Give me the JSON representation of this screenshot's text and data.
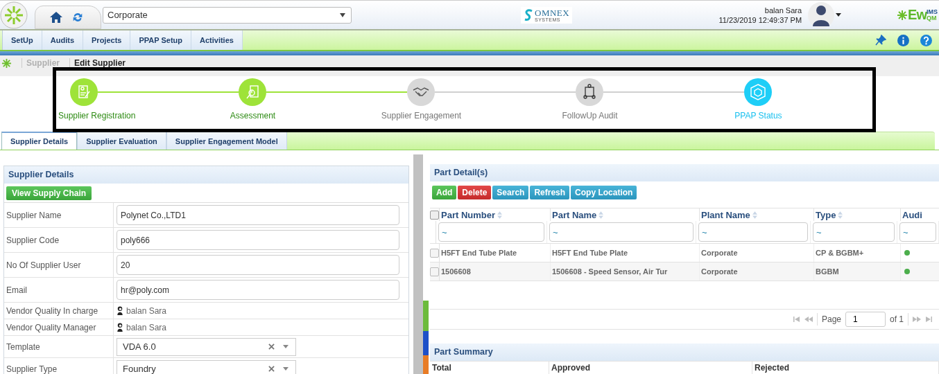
{
  "header": {
    "site_select": {
      "value": "Corporate"
    },
    "brand": {
      "name": "OMNEX",
      "tagline": "SYSTEMS"
    },
    "user": {
      "name": "balan Sara",
      "datetime": "11/23/2019 12:49:37 PM"
    },
    "product_logo": {
      "main": "Ew",
      "top": "IMS",
      "bottom": "QM"
    }
  },
  "nav": {
    "tabs": [
      {
        "label": "SetUp"
      },
      {
        "label": "Audits"
      },
      {
        "label": "Projects"
      },
      {
        "label": "PPAP Setup"
      },
      {
        "label": "Activities"
      }
    ]
  },
  "breadcrumb": [
    {
      "label": "Supplier",
      "current": false
    },
    {
      "label": "Edit Supplier",
      "current": true
    }
  ],
  "stepper": [
    {
      "label": "Supplier Registration",
      "done": true,
      "current": false
    },
    {
      "label": "Assessment",
      "done": true,
      "current": false
    },
    {
      "label": "Supplier Engagement",
      "done": false,
      "current": false
    },
    {
      "label": "FollowUp Audit",
      "done": false,
      "current": false
    },
    {
      "label": "PPAP Status",
      "done": false,
      "current": true
    }
  ],
  "tabs": [
    {
      "label": "Supplier Details",
      "selected": true
    },
    {
      "label": "Supplier Evaluation",
      "selected": false
    },
    {
      "label": "Supplier Engagement Model",
      "selected": false
    }
  ],
  "supplier_details": {
    "title": "Supplier Details",
    "button": "View Supply Chain",
    "fields": [
      {
        "label": "Supplier Name",
        "kind": "text",
        "value": "Polynet Co.,LTD1"
      },
      {
        "label": "Supplier Code",
        "kind": "text",
        "value": "poly666"
      },
      {
        "label": "No Of Supplier User",
        "kind": "text",
        "value": "20"
      },
      {
        "label": "Email",
        "kind": "text",
        "value": "hr@poly.com"
      },
      {
        "label": "Vendor Quality In charge",
        "kind": "person",
        "value": "balan Sara"
      },
      {
        "label": "Vendor Quality Manager",
        "kind": "person",
        "value": "balan Sara"
      },
      {
        "label": "Template",
        "kind": "select",
        "value": "VDA 6.0"
      },
      {
        "label": "Supplier Type",
        "kind": "select",
        "value": "Foundry"
      }
    ]
  },
  "part_details": {
    "title": "Part Detail(s)",
    "buttons": [
      {
        "label": "Add",
        "kind": "add"
      },
      {
        "label": "Delete",
        "kind": "delete"
      },
      {
        "label": "Search",
        "kind": "action"
      },
      {
        "label": "Refresh",
        "kind": "action"
      },
      {
        "label": "Copy Location",
        "kind": "action"
      }
    ],
    "table": {
      "all_checked": false,
      "columns": [
        {
          "label": "Part Number",
          "filter": "~"
        },
        {
          "label": "Part Name",
          "filter": "~"
        },
        {
          "label": "Plant Name",
          "filter": "~"
        },
        {
          "label": "Type",
          "filter": "~"
        },
        {
          "label": "Audi",
          "filter": "~"
        }
      ],
      "rows": [
        {
          "checked": false,
          "cells": [
            "H5FT End Tube Plate",
            "H5FT End Tube Plate",
            "Corporate",
            "CP & BGBM+"
          ],
          "color": "#4cae4c"
        },
        {
          "checked": false,
          "cells": [
            "1506608",
            "1506608 - Speed Sensor, Air Tur",
            "Corporate",
            "BGBM"
          ],
          "color": "#4cae4c"
        }
      ]
    },
    "pager": {
      "label": "Page",
      "page": "1",
      "total": "of 1"
    }
  },
  "part_summary": {
    "title": "Part Summary",
    "columns": [
      "Total",
      "Approved",
      "Rejected"
    ]
  }
}
